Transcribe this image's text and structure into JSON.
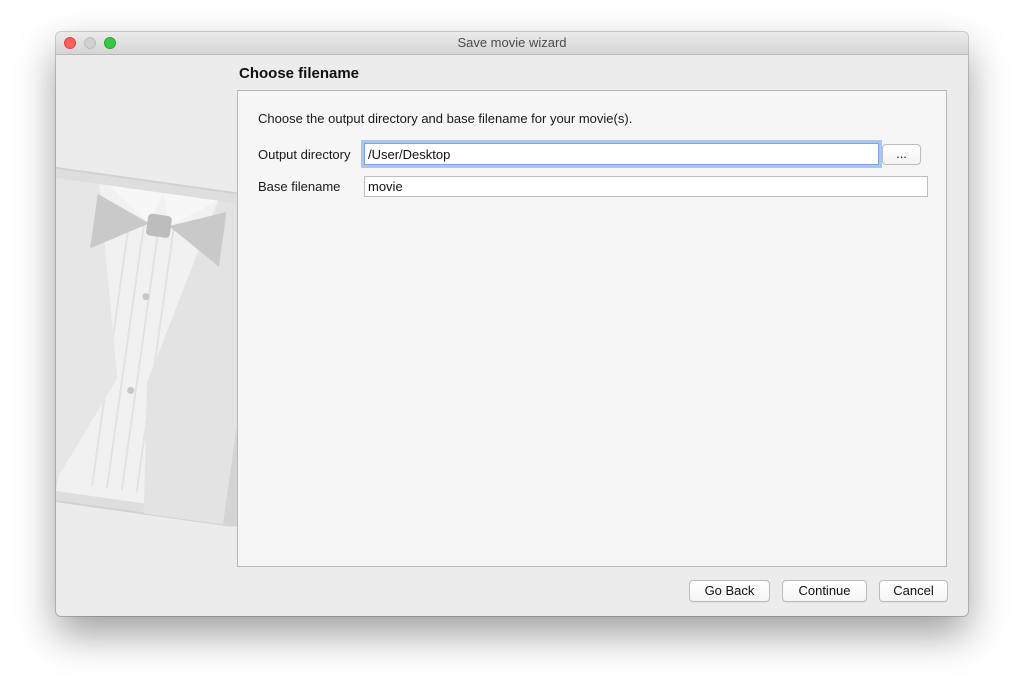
{
  "window": {
    "title": "Save movie wizard"
  },
  "page": {
    "heading": "Choose filename",
    "description": "Choose the output directory and base filename for your movie(s)."
  },
  "fields": {
    "output_directory": {
      "label": "Output directory",
      "value": "/User/Desktop",
      "browse_label": "..."
    },
    "base_filename": {
      "label": "Base filename",
      "value": "movie"
    }
  },
  "buttons": {
    "back": "Go Back",
    "continue": "Continue",
    "cancel": "Cancel"
  },
  "icons": {
    "sidebar": "tuxedo-icon"
  },
  "colors": {
    "focus_ring": "#6aa1eb",
    "close": "#fc605b",
    "zoom": "#34c84a"
  }
}
